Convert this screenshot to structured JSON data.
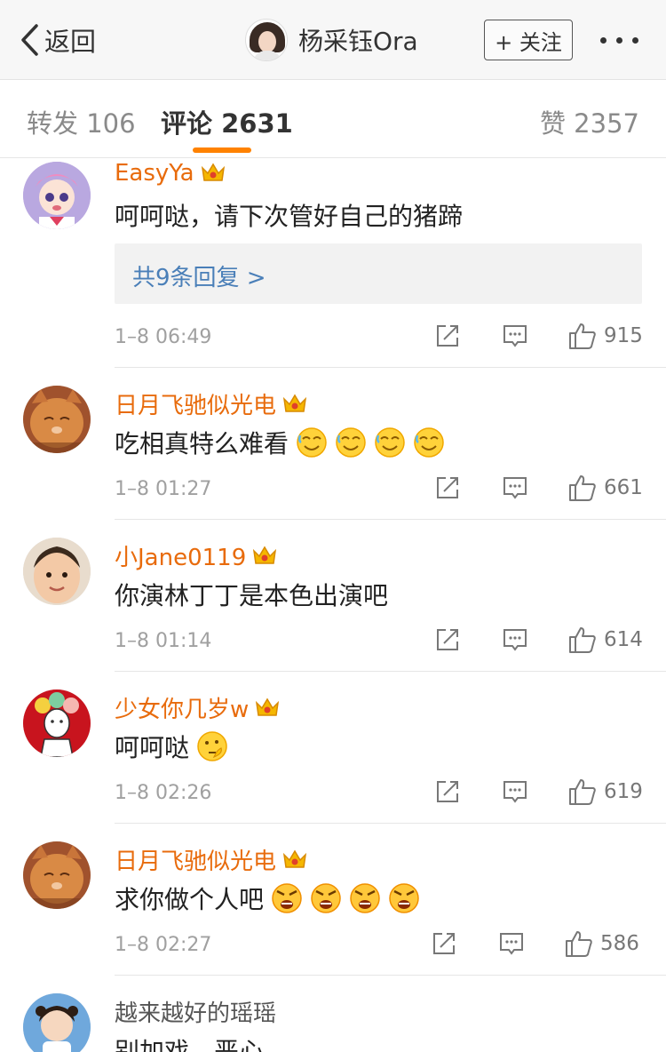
{
  "nav": {
    "back_label": "返回",
    "account_name": "杨采钰Ora",
    "follow_label": "+ 关注"
  },
  "tabs": {
    "repost": "转发 106",
    "comments": "评论 2631",
    "likes": "赞 2357"
  },
  "colors": {
    "accent": "#ff8200",
    "username": "#e86b0c",
    "link": "#4a7fb8"
  },
  "comments": [
    {
      "user": "EasyYa",
      "text": "呵呵哒，请下次管好自己的猪蹄",
      "replies": "共9条回复 >",
      "time": "1–8 06:49",
      "likes": "915",
      "emojis": []
    },
    {
      "user": "日月飞驰似光电",
      "text": "吃相真特么难看",
      "time": "1–8 01:27",
      "likes": "661",
      "emojis": [
        "sweat-laugh-emoji",
        "sweat-laugh-emoji",
        "sweat-laugh-emoji",
        "sweat-laugh-emoji"
      ]
    },
    {
      "user": "小Jane0119",
      "text": "你演林丁丁是本色出演吧",
      "time": "1–8 01:14",
      "likes": "614",
      "emojis": []
    },
    {
      "user": "少女你几岁w",
      "text": "呵呵哒",
      "time": "1–8 02:26",
      "likes": "619",
      "emojis": [
        "thinking-emoji"
      ]
    },
    {
      "user": "日月飞驰似光电",
      "text": "求你做个人吧",
      "time": "1–8 02:27",
      "likes": "586",
      "emojis": [
        "angry-emoji",
        "angry-emoji",
        "angry-emoji",
        "angry-emoji"
      ]
    },
    {
      "user": "越来越好的瑶瑶",
      "text": "别加戏，恶心"
    }
  ]
}
